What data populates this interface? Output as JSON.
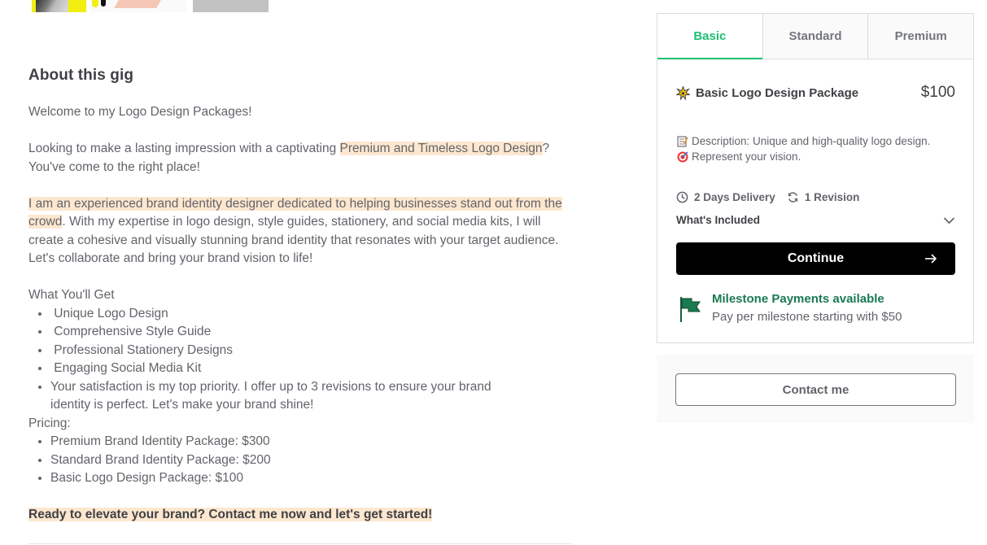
{
  "about": {
    "title": "About this gig",
    "welcome": "Welcome to my Logo Design Packages!",
    "p2_before": "Looking to make a lasting impression with a captivating ",
    "p2_highlight": "Premium and Timeless Logo Design",
    "p2_after": "? You've come to the right place!",
    "p3_highlight": "I am an experienced brand identity designer dedicated to helping businesses stand out from the crowd",
    "p3_after": ". With my expertise in logo design, style guides, stationery, and social media kits, I will create a cohesive and visually stunning brand identity that resonates with your target audience. Let's collaborate and bring your brand vision to life!",
    "get_heading": "What You'll Get",
    "get_items": [
      " Unique Logo Design",
      " Comprehensive Style Guide",
      " Professional Stationery Designs",
      " Engaging Social Media Kit",
      "Your satisfaction is my top priority. I offer up to 3 revisions to ensure your brand identity is perfect. Let's make your brand shine!"
    ],
    "pricing_heading": "Pricing:",
    "pricing_items": [
      "Premium Brand Identity Package: $300",
      "Standard Brand Identity Package: $200",
      "Basic Logo Design Package: $100"
    ],
    "final": "Ready to elevate your brand? Contact me now and let's get started!"
  },
  "package": {
    "tabs": [
      "Basic",
      "Standard",
      "Premium"
    ],
    "active_tab": "Basic",
    "title_icon": "sparkle-emoji-icon",
    "title": "Basic Logo Design Package",
    "price": "$100",
    "desc_line1": "Description: Unique and high-quality logo design.",
    "desc_line2": "Represent your vision.",
    "delivery": "2 Days Delivery",
    "revisions": "1 Revision",
    "whats_included": "What's Included",
    "continue_label": "Continue",
    "milestone_title": "Milestone Payments available",
    "milestone_sub": "Pay per milestone starting with $50"
  },
  "contact": {
    "label": "Contact me"
  },
  "colors": {
    "accent": "#1dbf73",
    "highlight": "#fde7cf",
    "milestone": "#1a7a50",
    "text": "#404145",
    "muted": "#62646a"
  }
}
